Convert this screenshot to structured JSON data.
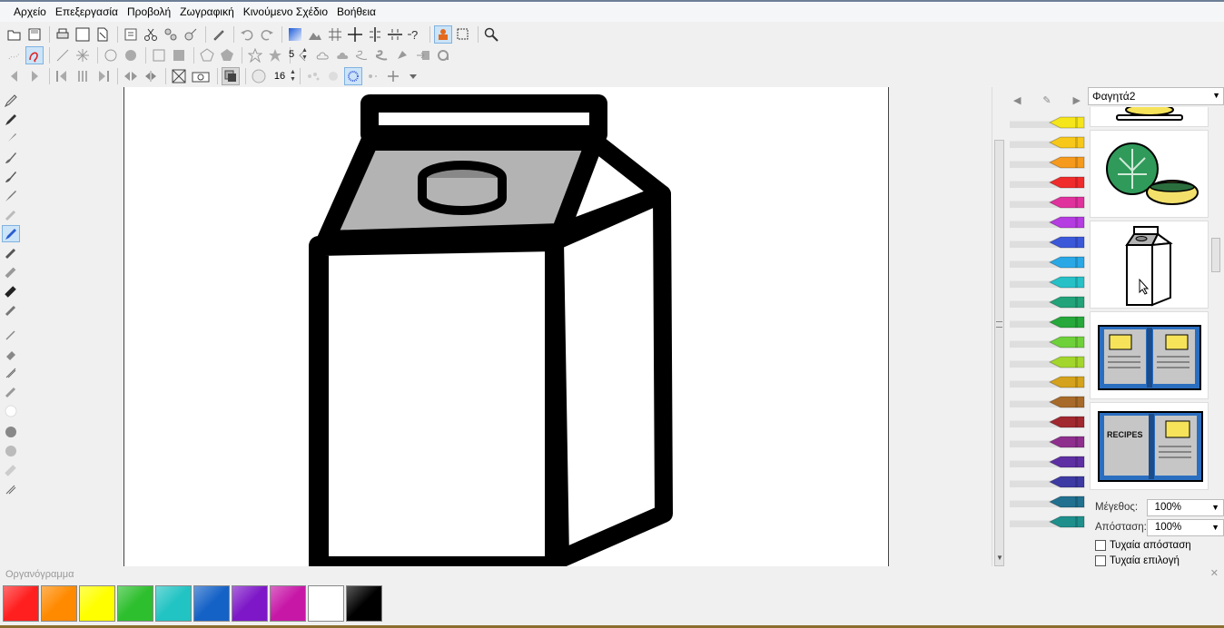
{
  "menu": [
    "Αρχείο",
    "Επεξεργασία",
    "Προβολή",
    "Ζωγραφική",
    "Κινούμενο Σχέδιο",
    "Βοήθεια"
  ],
  "toolbar": {
    "row1_icons": [
      "open-icon",
      "save-icon",
      "print-icon",
      "new-page-icon",
      "page-icon",
      "properties-icon",
      "cut-icon",
      "copy-icon",
      "paste-icon",
      "pick-color-icon",
      "undo-icon",
      "redo-icon",
      "gradient-icon",
      "hills-icon",
      "grid-icon",
      "crosshair-icon",
      "mirror-v-icon",
      "mirror-h-icon",
      "help-icon",
      "stamp-icon",
      "select-rect-icon",
      "zoom-icon"
    ],
    "row2_icons": [
      "dots-icon",
      "freehand-icon",
      "line-icon",
      "burst-icon",
      "circle-outline-icon",
      "circle-filled-icon",
      "square-outline-icon",
      "square-filled-icon",
      "pentagon-outline-icon",
      "pentagon-filled-icon",
      "star-outline-icon",
      "star-filled-icon",
      "curve-icon",
      "cloud-icon",
      "blob-icon",
      "swirl-icon",
      "wave-icon",
      "fill-shape-icon",
      "arrow-box-icon",
      "spiral-icon"
    ],
    "row3_icons": [
      "prev-icon",
      "next-icon",
      "first-frame-icon",
      "frames-icon",
      "last-frame-icon",
      "flip-h-icon",
      "flip-v-icon",
      "resize-icon",
      "camera-icon",
      "layers-icon",
      "brush-size-icon",
      "particles-icon",
      "sparkle-icon",
      "plus-icon",
      "dropdown-icon"
    ],
    "spinner1_value": "5",
    "spinner2_value": "16"
  },
  "gallery": {
    "category": "Φαγητά2",
    "items": [
      "banana-plate",
      "lettuce-and-salad-bowl",
      "milk-carton",
      "recipe-book-open",
      "recipe-book-cover"
    ],
    "recipe_label": "RECIPES",
    "size_label": "Μέγεθος:",
    "size_value": "100%",
    "distance_label": "Απόσταση:",
    "distance_value": "100%",
    "random_distance": "Τυχαία απόσταση",
    "random_selection": "Τυχαία επιλογή"
  },
  "crayon_colors": [
    "#f5e51b",
    "#f7c81a",
    "#f59a1d",
    "#ef2b2b",
    "#e0329c",
    "#b53ce0",
    "#3b58d9",
    "#2aa8e6",
    "#27c0c7",
    "#22a37a",
    "#26a83a",
    "#6fd13a",
    "#a3d62c",
    "#d4a21c",
    "#a86a2a",
    "#a0282e",
    "#8e2f8e",
    "#5e2fa3",
    "#3e3aa3",
    "#21708f",
    "#1f8f8c"
  ],
  "palette": {
    "title": "Οργανόγραμμα",
    "colors": [
      "#ff1f1f",
      "#ff8a00",
      "#ffff00",
      "#2dbf2d",
      "#22c3c3",
      "#1562c7",
      "#7d17c7",
      "#c717a7",
      "#ffffff",
      "#000000"
    ]
  }
}
